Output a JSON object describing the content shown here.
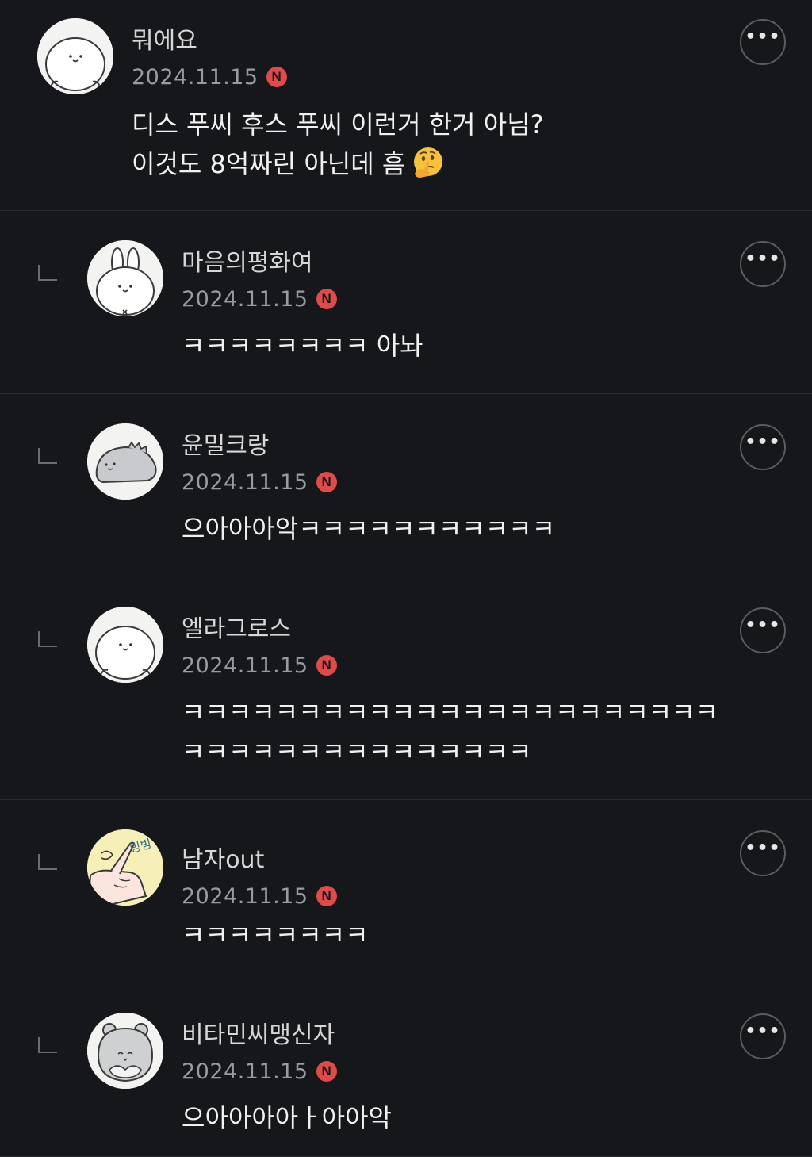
{
  "comments": [
    {
      "nickname": "뭐에요",
      "date": "2024.11.15",
      "badge": "N",
      "lines": [
        "디스 푸씨 후스 푸씨 이런거 한거 아님?",
        "이것도 8억짜린 아닌데 흠"
      ],
      "emoji": "thinking-face-icon",
      "avatar": "smiling-blob-avatar",
      "reply": false
    },
    {
      "nickname": "마음의평화여",
      "date": "2024.11.15",
      "badge": "N",
      "lines": [
        "ㅋㅋㅋㅋㅋㅋㅋㅋ 아놔"
      ],
      "avatar": "bunny-avatar",
      "reply": true
    },
    {
      "nickname": "윤밀크랑",
      "date": "2024.11.15",
      "badge": "N",
      "lines": [
        "으아아아악ㅋㅋㅋㅋㅋㅋㅋㅋㅋㅋㅋ"
      ],
      "avatar": "hedgehog-avatar",
      "reply": true
    },
    {
      "nickname": "엘라그로스",
      "date": "2024.11.15",
      "badge": "N",
      "lines": [
        "ㅋㅋㅋㅋㅋㅋㅋㅋㅋㅋㅋㅋㅋㅋㅋㅋㅋㅋㅋㅋㅋㅋㅋ",
        "ㅋㅋㅋㅋㅋㅋㅋㅋㅋㅋㅋㅋㅋㅋㅋ"
      ],
      "avatar": "smiling-blob-avatar",
      "reply": true
    },
    {
      "nickname": "남자out",
      "date": "2024.11.15",
      "badge": "N",
      "lines": [
        "ㅋㅋㅋㅋㅋㅋㅋㅋ"
      ],
      "avatar": "finger-twirl-avatar",
      "avatar_text": "빙빙",
      "reply": true
    },
    {
      "nickname": "비타민씨맹신자",
      "date": "2024.11.15",
      "badge": "N",
      "lines": [
        "으아아아아ㅏ아아악"
      ],
      "avatar": "hamster-avatar",
      "reply": true
    }
  ],
  "colors": {
    "background": "#16171a",
    "divider": "#2b2c30",
    "badge": "#e04a4a",
    "date": "#9a9b9f"
  },
  "more_button_icon": "more-horizontal-icon"
}
